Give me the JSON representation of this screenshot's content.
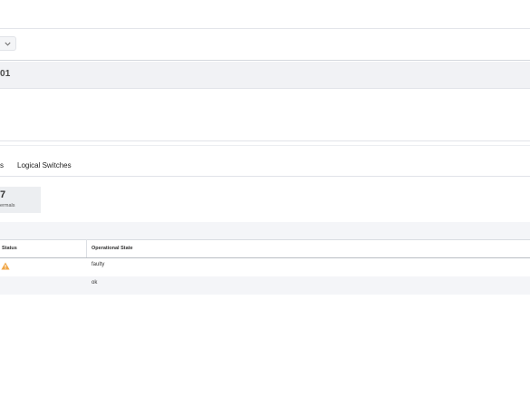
{
  "header": {
    "title_partial": "01"
  },
  "tabs": [
    {
      "label": "s"
    },
    {
      "label": "Logical Switches"
    }
  ],
  "stat": {
    "value": "7",
    "label": "ermals"
  },
  "table": {
    "columns": [
      "Status",
      "Operational State"
    ],
    "rows": [
      {
        "status_icon": "warning-icon",
        "operational_state": "faulty"
      },
      {
        "status_icon": "",
        "operational_state": "ok"
      }
    ]
  },
  "colors": {
    "warning": "#f0a646",
    "title_bar_bg": "#f1f2f5",
    "divider": "#d9dce1"
  }
}
